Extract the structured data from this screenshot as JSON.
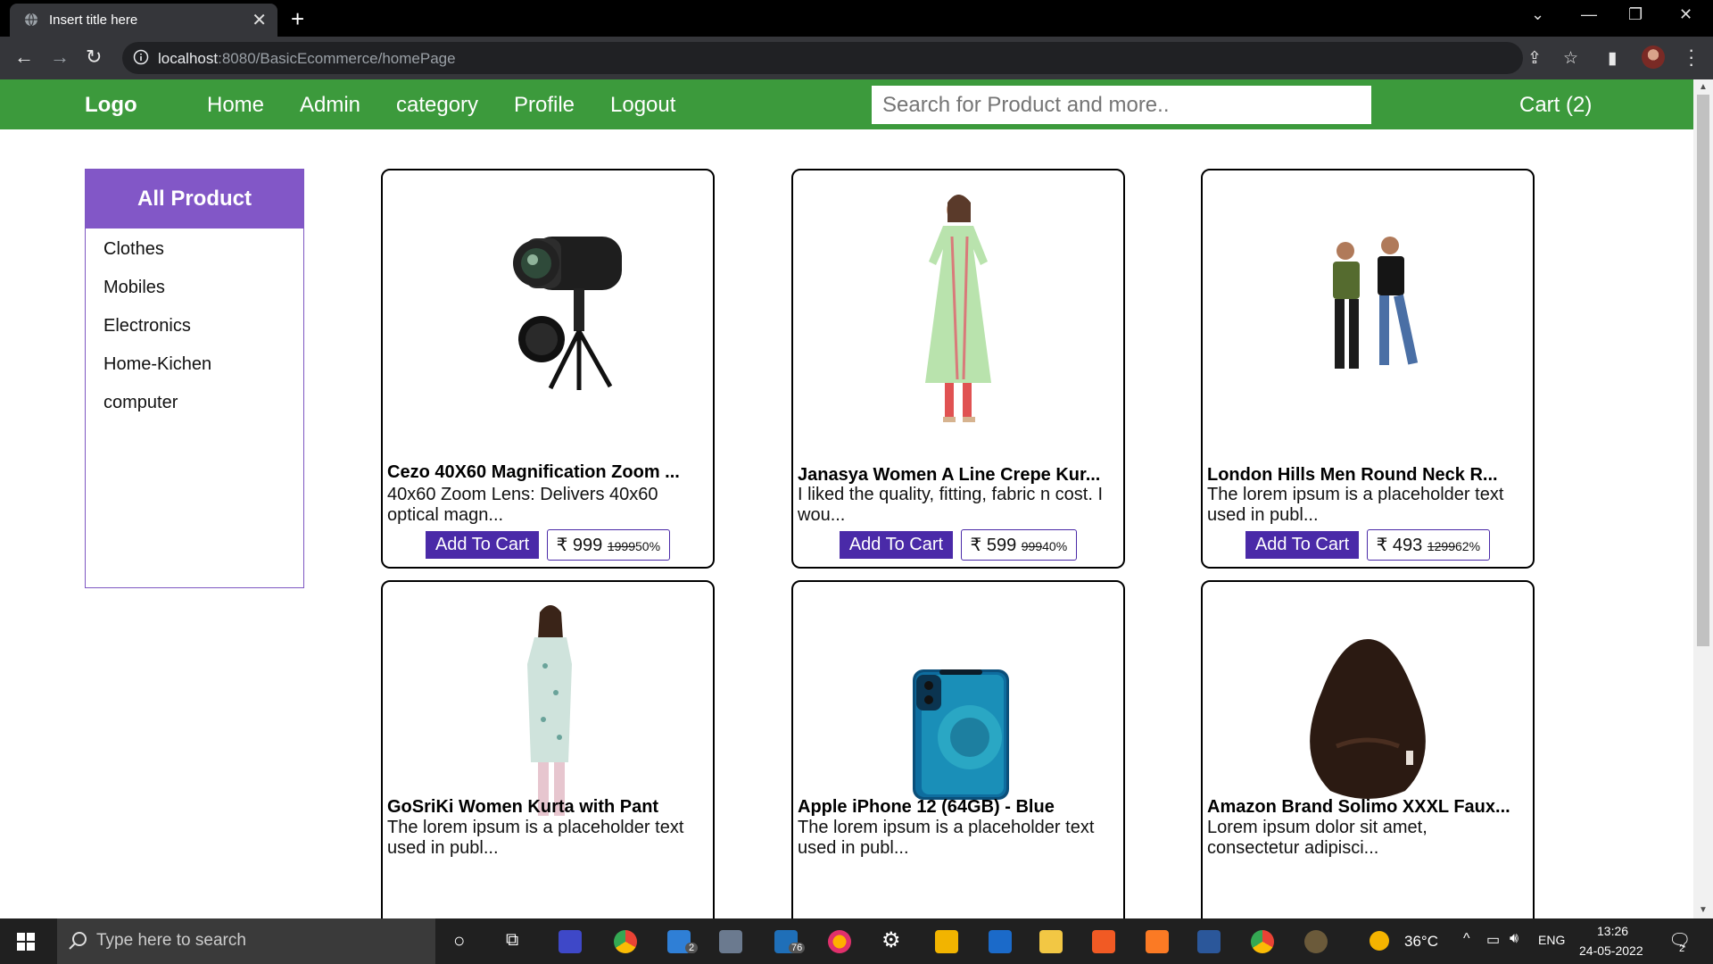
{
  "browser": {
    "tab_title": "Insert title here",
    "close": "✕",
    "newtab": "+",
    "url_host": "localhost",
    "url_path": ":8080/BasicEcommerce/homePage"
  },
  "navbar": {
    "logo": "Logo",
    "links": [
      "Home",
      "Admin",
      "category",
      "Profile",
      "Logout"
    ],
    "search_placeholder": "Search for Product and more..",
    "cart": "Cart (2)"
  },
  "sidebar": {
    "heading": "All Product",
    "items": [
      "Clothes",
      "Mobiles",
      "Electronics",
      "Home-Kichen",
      "computer"
    ]
  },
  "products": [
    {
      "title": "Cezo 40X60 Magnification Zoom ...",
      "desc": "40x60 Zoom Lens:  Delivers 40x60 optical magn...",
      "button": "Add To Cart",
      "price": "₹ 999",
      "mrp": "1999",
      "discount": "50%",
      "icon": "monocular-image"
    },
    {
      "title": "Janasya Women A Line Crepe Kur...",
      "desc": "I liked the quality, fitting, fabric n cost. I wou...",
      "button": "Add To Cart",
      "price": "₹ 599",
      "mrp": "999",
      "discount": "40%",
      "icon": "kurti-image"
    },
    {
      "title": "London Hills Men Round Neck R...",
      "desc": "The lorem ipsum is a placeholder text used in publ...",
      "button": "Add To Cart",
      "price": "₹ 493",
      "mrp": "1299",
      "discount": "62%",
      "icon": "tshirts-image"
    },
    {
      "title": "GoSriKi Women Kurta with Pant",
      "desc": "The lorem ipsum is a placeholder text used in publ...",
      "icon": "kurta-pant-image"
    },
    {
      "title": "Apple iPhone 12 (64GB) - Blue",
      "desc": "The lorem ipsum is a placeholder text used in publ...",
      "icon": "iphone-image"
    },
    {
      "title": "Amazon Brand Solimo XXXL Faux...",
      "desc": "Lorem ipsum dolor sit amet, consectetur adipisci...",
      "icon": "bean-bag-image"
    }
  ],
  "taskbar": {
    "search_placeholder": "Type here to search",
    "badge_mail": "2",
    "badge_app": "76",
    "weather": "36°C",
    "lang": "ENG",
    "time": "13:26",
    "date": "24-05-2022",
    "notifications": "2"
  },
  "colors": {
    "nav_green": "#3c9a3c",
    "accent_purple": "#4a2aa8",
    "sidebar_purple": "#8257c7"
  }
}
